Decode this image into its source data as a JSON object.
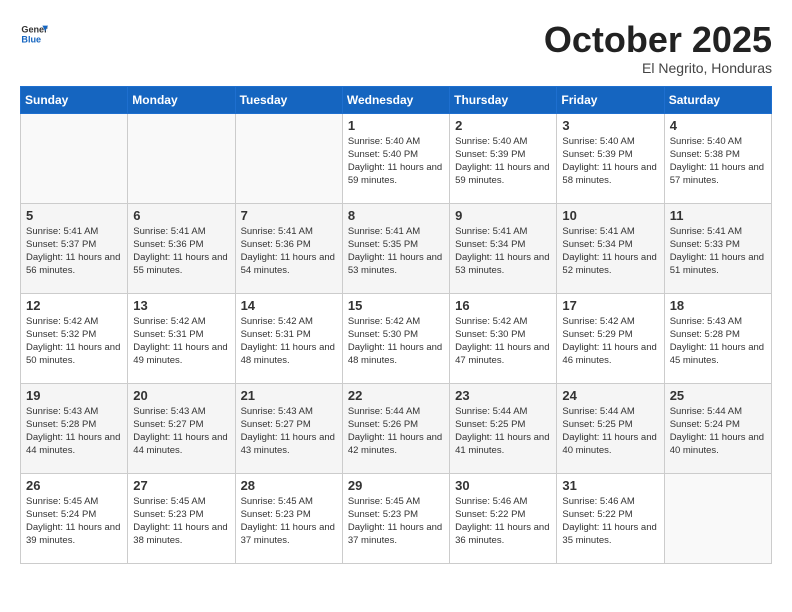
{
  "header": {
    "logo_general": "General",
    "logo_blue": "Blue",
    "month_title": "October 2025",
    "subtitle": "El Negrito, Honduras"
  },
  "days_of_week": [
    "Sunday",
    "Monday",
    "Tuesday",
    "Wednesday",
    "Thursday",
    "Friday",
    "Saturday"
  ],
  "weeks": [
    [
      {
        "day": "",
        "info": ""
      },
      {
        "day": "",
        "info": ""
      },
      {
        "day": "",
        "info": ""
      },
      {
        "day": "1",
        "info": "Sunrise: 5:40 AM\nSunset: 5:40 PM\nDaylight: 11 hours and 59 minutes."
      },
      {
        "day": "2",
        "info": "Sunrise: 5:40 AM\nSunset: 5:39 PM\nDaylight: 11 hours and 59 minutes."
      },
      {
        "day": "3",
        "info": "Sunrise: 5:40 AM\nSunset: 5:39 PM\nDaylight: 11 hours and 58 minutes."
      },
      {
        "day": "4",
        "info": "Sunrise: 5:40 AM\nSunset: 5:38 PM\nDaylight: 11 hours and 57 minutes."
      }
    ],
    [
      {
        "day": "5",
        "info": "Sunrise: 5:41 AM\nSunset: 5:37 PM\nDaylight: 11 hours and 56 minutes."
      },
      {
        "day": "6",
        "info": "Sunrise: 5:41 AM\nSunset: 5:36 PM\nDaylight: 11 hours and 55 minutes."
      },
      {
        "day": "7",
        "info": "Sunrise: 5:41 AM\nSunset: 5:36 PM\nDaylight: 11 hours and 54 minutes."
      },
      {
        "day": "8",
        "info": "Sunrise: 5:41 AM\nSunset: 5:35 PM\nDaylight: 11 hours and 53 minutes."
      },
      {
        "day": "9",
        "info": "Sunrise: 5:41 AM\nSunset: 5:34 PM\nDaylight: 11 hours and 53 minutes."
      },
      {
        "day": "10",
        "info": "Sunrise: 5:41 AM\nSunset: 5:34 PM\nDaylight: 11 hours and 52 minutes."
      },
      {
        "day": "11",
        "info": "Sunrise: 5:41 AM\nSunset: 5:33 PM\nDaylight: 11 hours and 51 minutes."
      }
    ],
    [
      {
        "day": "12",
        "info": "Sunrise: 5:42 AM\nSunset: 5:32 PM\nDaylight: 11 hours and 50 minutes."
      },
      {
        "day": "13",
        "info": "Sunrise: 5:42 AM\nSunset: 5:31 PM\nDaylight: 11 hours and 49 minutes."
      },
      {
        "day": "14",
        "info": "Sunrise: 5:42 AM\nSunset: 5:31 PM\nDaylight: 11 hours and 48 minutes."
      },
      {
        "day": "15",
        "info": "Sunrise: 5:42 AM\nSunset: 5:30 PM\nDaylight: 11 hours and 48 minutes."
      },
      {
        "day": "16",
        "info": "Sunrise: 5:42 AM\nSunset: 5:30 PM\nDaylight: 11 hours and 47 minutes."
      },
      {
        "day": "17",
        "info": "Sunrise: 5:42 AM\nSunset: 5:29 PM\nDaylight: 11 hours and 46 minutes."
      },
      {
        "day": "18",
        "info": "Sunrise: 5:43 AM\nSunset: 5:28 PM\nDaylight: 11 hours and 45 minutes."
      }
    ],
    [
      {
        "day": "19",
        "info": "Sunrise: 5:43 AM\nSunset: 5:28 PM\nDaylight: 11 hours and 44 minutes."
      },
      {
        "day": "20",
        "info": "Sunrise: 5:43 AM\nSunset: 5:27 PM\nDaylight: 11 hours and 44 minutes."
      },
      {
        "day": "21",
        "info": "Sunrise: 5:43 AM\nSunset: 5:27 PM\nDaylight: 11 hours and 43 minutes."
      },
      {
        "day": "22",
        "info": "Sunrise: 5:44 AM\nSunset: 5:26 PM\nDaylight: 11 hours and 42 minutes."
      },
      {
        "day": "23",
        "info": "Sunrise: 5:44 AM\nSunset: 5:25 PM\nDaylight: 11 hours and 41 minutes."
      },
      {
        "day": "24",
        "info": "Sunrise: 5:44 AM\nSunset: 5:25 PM\nDaylight: 11 hours and 40 minutes."
      },
      {
        "day": "25",
        "info": "Sunrise: 5:44 AM\nSunset: 5:24 PM\nDaylight: 11 hours and 40 minutes."
      }
    ],
    [
      {
        "day": "26",
        "info": "Sunrise: 5:45 AM\nSunset: 5:24 PM\nDaylight: 11 hours and 39 minutes."
      },
      {
        "day": "27",
        "info": "Sunrise: 5:45 AM\nSunset: 5:23 PM\nDaylight: 11 hours and 38 minutes."
      },
      {
        "day": "28",
        "info": "Sunrise: 5:45 AM\nSunset: 5:23 PM\nDaylight: 11 hours and 37 minutes."
      },
      {
        "day": "29",
        "info": "Sunrise: 5:45 AM\nSunset: 5:23 PM\nDaylight: 11 hours and 37 minutes."
      },
      {
        "day": "30",
        "info": "Sunrise: 5:46 AM\nSunset: 5:22 PM\nDaylight: 11 hours and 36 minutes."
      },
      {
        "day": "31",
        "info": "Sunrise: 5:46 AM\nSunset: 5:22 PM\nDaylight: 11 hours and 35 minutes."
      },
      {
        "day": "",
        "info": ""
      }
    ]
  ]
}
